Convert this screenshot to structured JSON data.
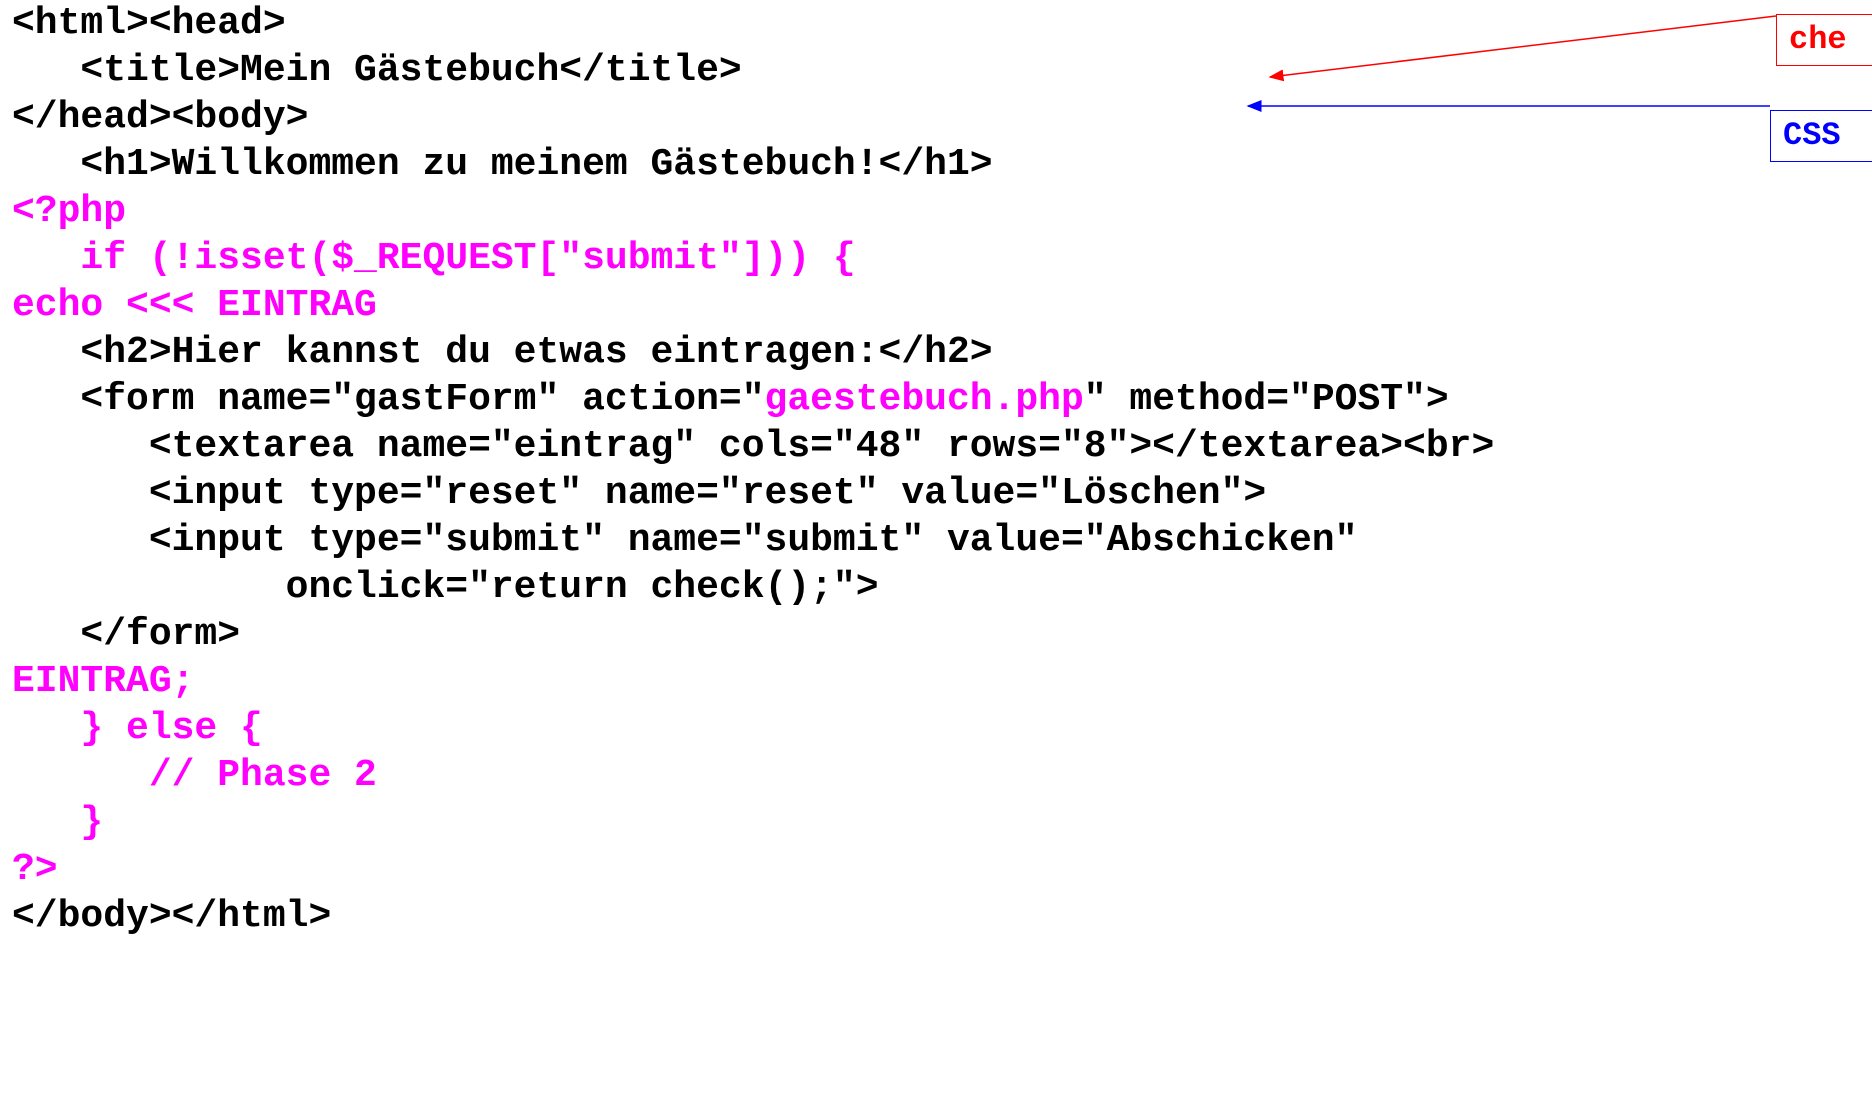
{
  "code_lines": [
    {
      "parts": [
        {
          "t": "<html><head>",
          "c": "blk"
        }
      ]
    },
    {
      "parts": [
        {
          "t": "   <title>Mein Gästebuch</title>",
          "c": "blk"
        }
      ]
    },
    {
      "parts": [
        {
          "t": "</head><body>",
          "c": "blk"
        }
      ]
    },
    {
      "parts": [
        {
          "t": "   <h1>Willkommen zu meinem Gästebuch!</h1>",
          "c": "blk"
        }
      ]
    },
    {
      "parts": [
        {
          "t": "<?php",
          "c": "php"
        }
      ]
    },
    {
      "parts": [
        {
          "t": "   if (!isset($_REQUEST[\"submit\"])) {",
          "c": "php"
        }
      ]
    },
    {
      "parts": [
        {
          "t": "echo <<< EINTRAG",
          "c": "php"
        }
      ]
    },
    {
      "parts": [
        {
          "t": "   <h2>Hier kannst du etwas eintragen:</h2>",
          "c": "blk"
        }
      ]
    },
    {
      "parts": [
        {
          "t": "   <form name=\"gastForm\" action=\"",
          "c": "blk"
        },
        {
          "t": "gaestebuch.php",
          "c": "php"
        },
        {
          "t": "\" method=\"POST\">",
          "c": "blk"
        }
      ]
    },
    {
      "parts": [
        {
          "t": "      <textarea name=\"eintrag\" cols=\"48\" rows=\"8\"></textarea><br>",
          "c": "blk"
        }
      ]
    },
    {
      "parts": [
        {
          "t": "      <input type=\"reset\" name=\"reset\" value=\"Löschen\">",
          "c": "blk"
        }
      ]
    },
    {
      "parts": [
        {
          "t": "      <input type=\"submit\" name=\"submit\" value=\"Abschicken\"",
          "c": "blk"
        }
      ]
    },
    {
      "parts": [
        {
          "t": "            onclick=\"return check();\">",
          "c": "blk"
        }
      ]
    },
    {
      "parts": [
        {
          "t": "   </form>",
          "c": "blk"
        }
      ]
    },
    {
      "parts": [
        {
          "t": "EINTRAG;",
          "c": "php"
        }
      ]
    },
    {
      "parts": [
        {
          "t": "   } else {",
          "c": "php"
        }
      ]
    },
    {
      "parts": [
        {
          "t": "      // Phase 2",
          "c": "php"
        }
      ]
    },
    {
      "parts": [
        {
          "t": "   }",
          "c": "php"
        }
      ]
    },
    {
      "parts": [
        {
          "t": "?>",
          "c": "php"
        }
      ]
    },
    {
      "parts": [
        {
          "t": "</body></html>",
          "c": "blk"
        }
      ]
    }
  ],
  "annotations": {
    "red_label": "che",
    "blue_label": "CSS"
  },
  "colors": {
    "php": "#ff00ff",
    "html": "#000000",
    "red_annotation": "#ff0000",
    "blue_annotation": "#0000ff"
  }
}
